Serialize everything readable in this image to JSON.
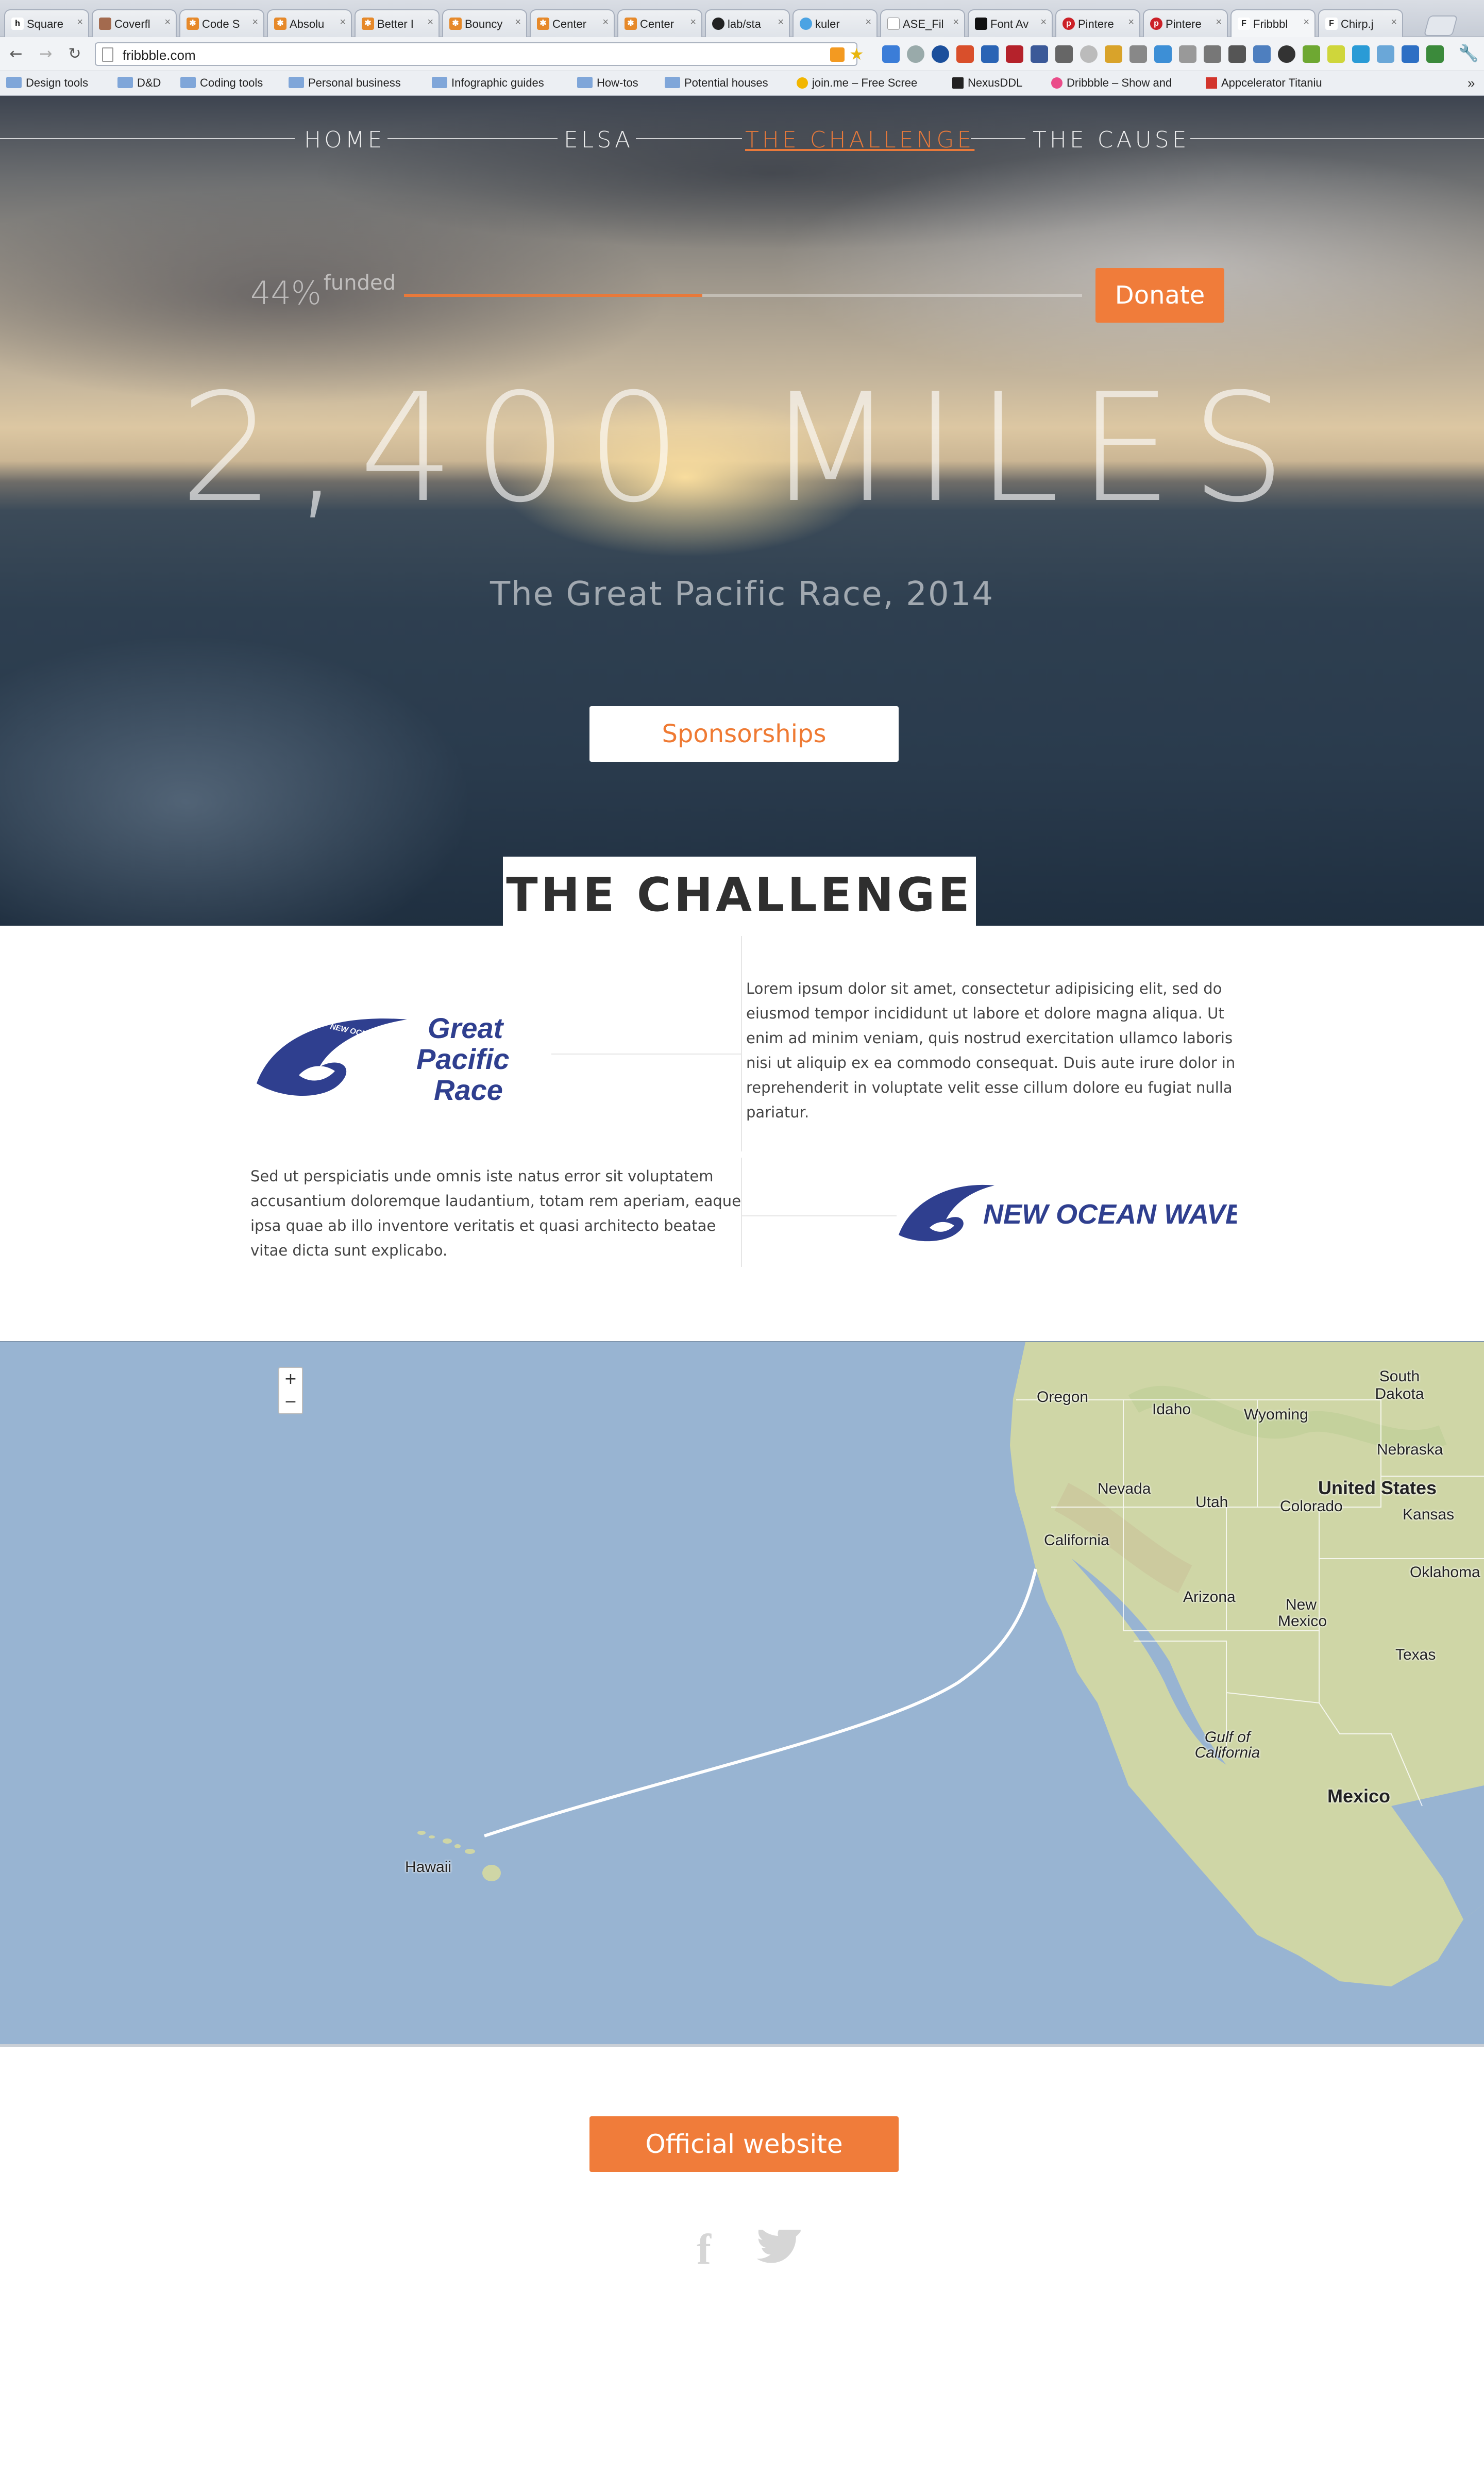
{
  "browser": {
    "tabs": [
      {
        "label": "Square",
        "icon": "h-icon"
      },
      {
        "label": "Coverfl",
        "icon": "avatar-icon"
      },
      {
        "label": "Code S",
        "icon": "asterisk-icon"
      },
      {
        "label": "Absolu",
        "icon": "asterisk-icon"
      },
      {
        "label": "Better I",
        "icon": "asterisk-icon"
      },
      {
        "label": "Bouncy",
        "icon": "asterisk-icon"
      },
      {
        "label": "Center",
        "icon": "asterisk-icon"
      },
      {
        "label": "Center",
        "icon": "asterisk-icon"
      },
      {
        "label": "lab/sta",
        "icon": "github-icon"
      },
      {
        "label": "kuler",
        "icon": "kuler-icon"
      },
      {
        "label": "ASE_Fil",
        "icon": "page-icon"
      },
      {
        "label": "Font Av",
        "icon": "font-awesome-icon"
      },
      {
        "label": "Pintere",
        "icon": "pinterest-icon"
      },
      {
        "label": "Pintere",
        "icon": "pinterest-icon"
      },
      {
        "label": "Fribbbl",
        "icon": "f-icon"
      },
      {
        "label": "Chirp.j",
        "icon": "f-icon"
      }
    ],
    "url": "fribbble.com",
    "bookmarks": [
      {
        "label": "Design tools",
        "icon": "folder-icon"
      },
      {
        "label": "D&D",
        "icon": "folder-icon"
      },
      {
        "label": "Coding tools",
        "icon": "folder-icon"
      },
      {
        "label": "Personal business",
        "icon": "folder-icon"
      },
      {
        "label": "Infographic guides",
        "icon": "folder-icon"
      },
      {
        "label": "How-tos",
        "icon": "folder-icon"
      },
      {
        "label": "Potential houses",
        "icon": "folder-icon"
      },
      {
        "label": "join.me – Free Scree",
        "icon": "joinme-icon"
      },
      {
        "label": "NexusDDL",
        "icon": "n-icon"
      },
      {
        "label": "Dribbble – Show and",
        "icon": "dribbble-icon"
      },
      {
        "label": "Appcelerator Titaniu",
        "icon": "appcelerator-icon"
      }
    ],
    "bookmarks_overflow": "»"
  },
  "nav": {
    "items": [
      {
        "label": "HOME"
      },
      {
        "label": "ELSA"
      },
      {
        "label": "THE CHALLENGE",
        "active": true
      },
      {
        "label": "THE CAUSE"
      }
    ]
  },
  "funding": {
    "percent_label": "44%",
    "word": "funded",
    "progress_fraction": 0.44,
    "donate_label": "Donate"
  },
  "hero": {
    "headline": "2,400 MILES",
    "subheadline": "The Great Pacific Race, 2014",
    "sponsorships_label": "Sponsorships"
  },
  "challenge": {
    "heading": "THE CHALLENGE",
    "sponsor1": {
      "logo_arc": "NEW OCEAN WAVE",
      "logo_lines": [
        "Great",
        "Pacific",
        "Race"
      ],
      "text_lines": [
        "Lorem ipsum dolor sit amet, consectetur adipisicing elit, sed do",
        "eiusmod tempor incididunt ut labore et dolore magna aliqua. Ut",
        "enim ad minim veniam, quis nostrud exercitation ullamco laboris",
        "nisi ut aliquip ex ea commodo consequat. Duis aute irure dolor in",
        "reprehenderit in voluptate velit esse cillum dolore eu fugiat nulla",
        "pariatur."
      ]
    },
    "sponsor2": {
      "logo_text": "NEW OCEAN WAVE",
      "text_lines": [
        "Sed ut perspiciatis unde omnis iste natus error sit voluptatem",
        "accusantium doloremque laudantium, totam rem aperiam, eaque",
        "ipsa quae ab illo inventore veritatis et quasi architecto beatae",
        "vitae dicta sunt explicabo."
      ]
    }
  },
  "map": {
    "zoom_in": "+",
    "zoom_out": "−",
    "labels": [
      "Oregon",
      "Idaho",
      "Wyoming",
      "South Dakota",
      "Nebraska",
      "United States",
      "Nevada",
      "Utah",
      "Colorado",
      "Kansas",
      "California",
      "Oklahoma",
      "Arizona",
      "New Mexico",
      "Texas",
      "Gulf of California",
      "Mexico",
      "Hawaii"
    ]
  },
  "footer": {
    "official_label": "Official website",
    "social": [
      "facebook-icon",
      "twitter-icon"
    ]
  },
  "colors": {
    "accent": "#f07c3a",
    "logo_blue": "#2f3f8f",
    "ocean": "#98b4d2",
    "land": "#cfd6a6"
  }
}
